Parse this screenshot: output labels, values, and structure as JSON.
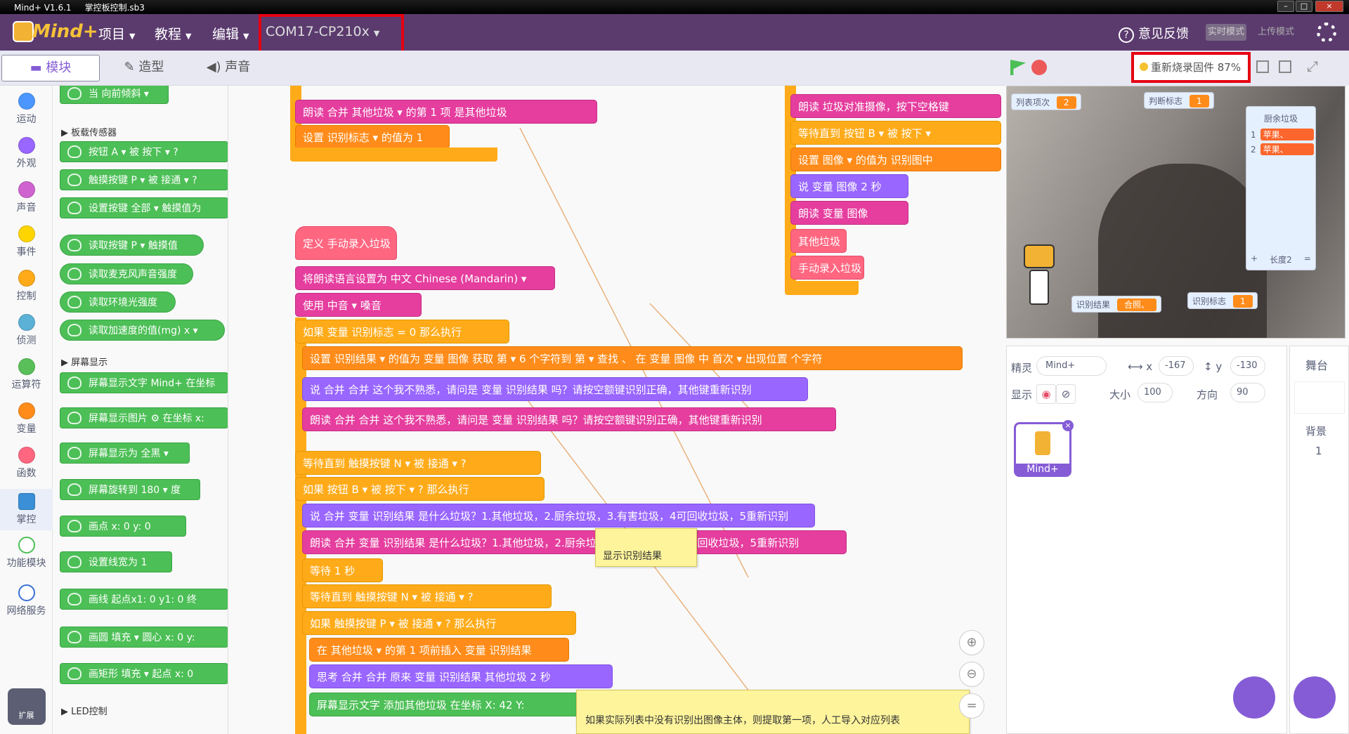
{
  "titlebar": {
    "app": "Mind+ V1.6.1",
    "file": "掌控板控制.sb3"
  },
  "menu": {
    "logo": "Mind+",
    "project": "项目",
    "tutorial": "教程",
    "edit": "编辑",
    "port": "COM17-CP210x",
    "feedback": "意见反馈",
    "realtime": "实时模式",
    "upload": "上传模式"
  },
  "tabs": {
    "blocks": "模块",
    "costumes": "造型",
    "sounds": "声音"
  },
  "categories": [
    {
      "label": "运动",
      "color": "#4c97ff"
    },
    {
      "label": "外观",
      "color": "#9966ff"
    },
    {
      "label": "声音",
      "color": "#cf63cf"
    },
    {
      "label": "事件",
      "color": "#ffd500"
    },
    {
      "label": "控制",
      "color": "#ffab19"
    },
    {
      "label": "侦测",
      "color": "#5cb1d6"
    },
    {
      "label": "运算符",
      "color": "#59c059"
    },
    {
      "label": "变量",
      "color": "#ff8c1a"
    },
    {
      "label": "函数",
      "color": "#ff6680"
    },
    {
      "label": "掌控",
      "color": "#3a8fd6"
    },
    {
      "label": "功能模块",
      "color": "#4cbf56"
    },
    {
      "label": "网络服务",
      "color": "#3a6fd6"
    },
    {
      "label": "扩展",
      "color": "#5c5f73"
    }
  ],
  "palette": {
    "top_block": "当 向前倾斜 ▾",
    "section_sensor": "板载传感器",
    "b1": "按钮 A ▾ 被 按下 ▾ ?",
    "b2": "触摸按键 P ▾ 被 接通 ▾ ?",
    "b3": "设置按键 全部 ▾ 触摸值为",
    "b4": "读取按键 P ▾ 触摸值",
    "b5": "读取麦克风声音强度",
    "b6": "读取环境光强度",
    "b7": "读取加速度的值(mg) x ▾",
    "section_screen": "屏幕显示",
    "b8": "屏幕显示文字 Mind+ 在坐标",
    "b9": "屏幕显示图片 ⚙ 在坐标 x:",
    "b10": "屏幕显示为 全黑 ▾",
    "b11": "屏幕旋转到 180 ▾ 度",
    "b12": "画点 x: 0 y: 0",
    "b13": "设置线宽为 1",
    "b14": "画线 起点x1: 0 y1: 0 终",
    "b15": "画圆 填充 ▾ 圆心 x: 0 y:",
    "b16": "画矩形 填充 ▾ 起点 x: 0",
    "section_led": "LED控制"
  },
  "script": {
    "s0": "朗读 合并 其他垃圾 ▾ 的第 1 项 是其他垃圾",
    "s1": "设置 识别标志 ▾ 的值为 1",
    "define": "定义 手动录入垃圾",
    "d1": "将朗读语言设置为 中文 Chinese (Mandarin) ▾",
    "d2": "使用 中音 ▾ 嗓音",
    "d3": "如果 变量 识别标志 = 0 那么执行",
    "d4": "设置 识别结果 ▾ 的值为 变量 图像 获取 第 ▾ 6 个字符到 第 ▾ 查找 、 在 变量 图像 中 首次 ▾ 出现位置 个字符",
    "d5": "说 合并 合并 这个我不熟悉，请问是 变量 识别结果 吗？请按空额键识别正确，其他键重新识别",
    "d6": "朗读 合并 合并 这个我不熟悉，请问是 变量 识别结果 吗？请按空额键识别正确，其他键重新识别",
    "d7": "等待直到 触摸按键 N ▾ 被 接通 ▾ ?",
    "d8": "如果 按钮 B ▾ 被 按下 ▾ ? 那么执行",
    "d9": "说 合并 变量 识别结果 是什么垃圾？1.其他垃圾，2.厨余垃圾，3.有害垃圾，4可回收垃圾，5重新识别",
    "d10": "朗读 合并 变量 识别结果 是什么垃圾？1.其他垃圾，2.厨余垃圾，3.有害垃圾，4可回收垃圾，5重新识别",
    "d11": "等待 1 秒",
    "d12": "等待直到 触摸按键 N ▾ 被 接通 ▾ ?",
    "d13": "如果 触摸按键 P ▾ 被 接通 ▾ ? 那么执行",
    "d14": "在 其他垃圾 ▾ 的第 1 项前插入 变量 识别结果",
    "d15": "思考 合并 合并 原来 变量 识别结果 其他垃圾 2 秒",
    "d16": "屏幕显示文字 添加其他垃圾 在坐标 X: 42 Y:",
    "r1": "朗读 垃圾对准摄像，按下空格键",
    "r2": "等待直到 按钮 B ▾ 被 按下 ▾",
    "r3": "设置 图像 ▾ 的值为 识别图中",
    "r4": "说 变量 图像 2 秒",
    "r5": "朗读 变量 图像",
    "r6": "其他垃圾",
    "r7": "手动录入垃圾",
    "note1": "显示识别结果",
    "note2": "如果实际列表中没有识别出图像主体，则提取第一项，人工导入对应列表"
  },
  "stage": {
    "firmware": "重新烧录固件 87%",
    "m_list_count": "列表项次",
    "m_list_count_val": "2",
    "m_judge": "判断标志",
    "m_judge_val": "1",
    "m_result": "识别结果",
    "m_result_val": "合照、",
    "m_flag": "识别标志",
    "m_flag_val": "1",
    "list_title": "厨余垃圾",
    "list_items": [
      "苹果、",
      "苹果、"
    ],
    "list_len": "长度2",
    "list_add": "+",
    "list_eq": "="
  },
  "sprite": {
    "sprite_label": "精灵",
    "sprite_name": "Mind+",
    "x_label": "x",
    "x": "-167",
    "y_label": "y",
    "y": "-130",
    "show_label": "显示",
    "size_label": "大小",
    "size": "100",
    "dir_label": "方向",
    "dir": "90",
    "thumb": "Mind+"
  },
  "stagecol": {
    "title": "舞台",
    "bg_label": "背景",
    "bg_count": "1"
  }
}
